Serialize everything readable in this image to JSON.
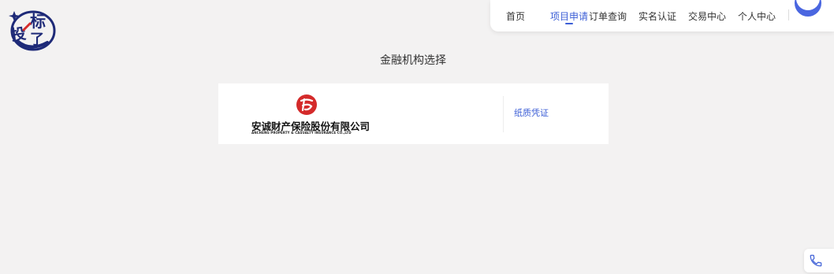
{
  "brand": {
    "logo_text": "投标了",
    "colors": {
      "navy": "#1e2a78",
      "red": "#d42a2a"
    }
  },
  "nav": {
    "items": [
      {
        "label": "首页",
        "active": false
      },
      {
        "label": "项目申请",
        "active": true
      },
      {
        "label": "订单查询",
        "active": false
      },
      {
        "label": "实名认证",
        "active": false
      },
      {
        "label": "交易中心",
        "active": false
      },
      {
        "label": "个人中心",
        "active": false
      }
    ],
    "accent_color": "#3d5fd6"
  },
  "main": {
    "title": "金融机构选择",
    "institutions": [
      {
        "name_cn": "安诚财产保险股份有限公司",
        "name_en": "ANCHENG PROPERTY & CASUALTY INSURANCE CO.,LTD",
        "emblem_color": "#d42a2a",
        "action_label": "纸质凭证"
      }
    ]
  },
  "floating": {
    "icon": "phone-icon"
  }
}
